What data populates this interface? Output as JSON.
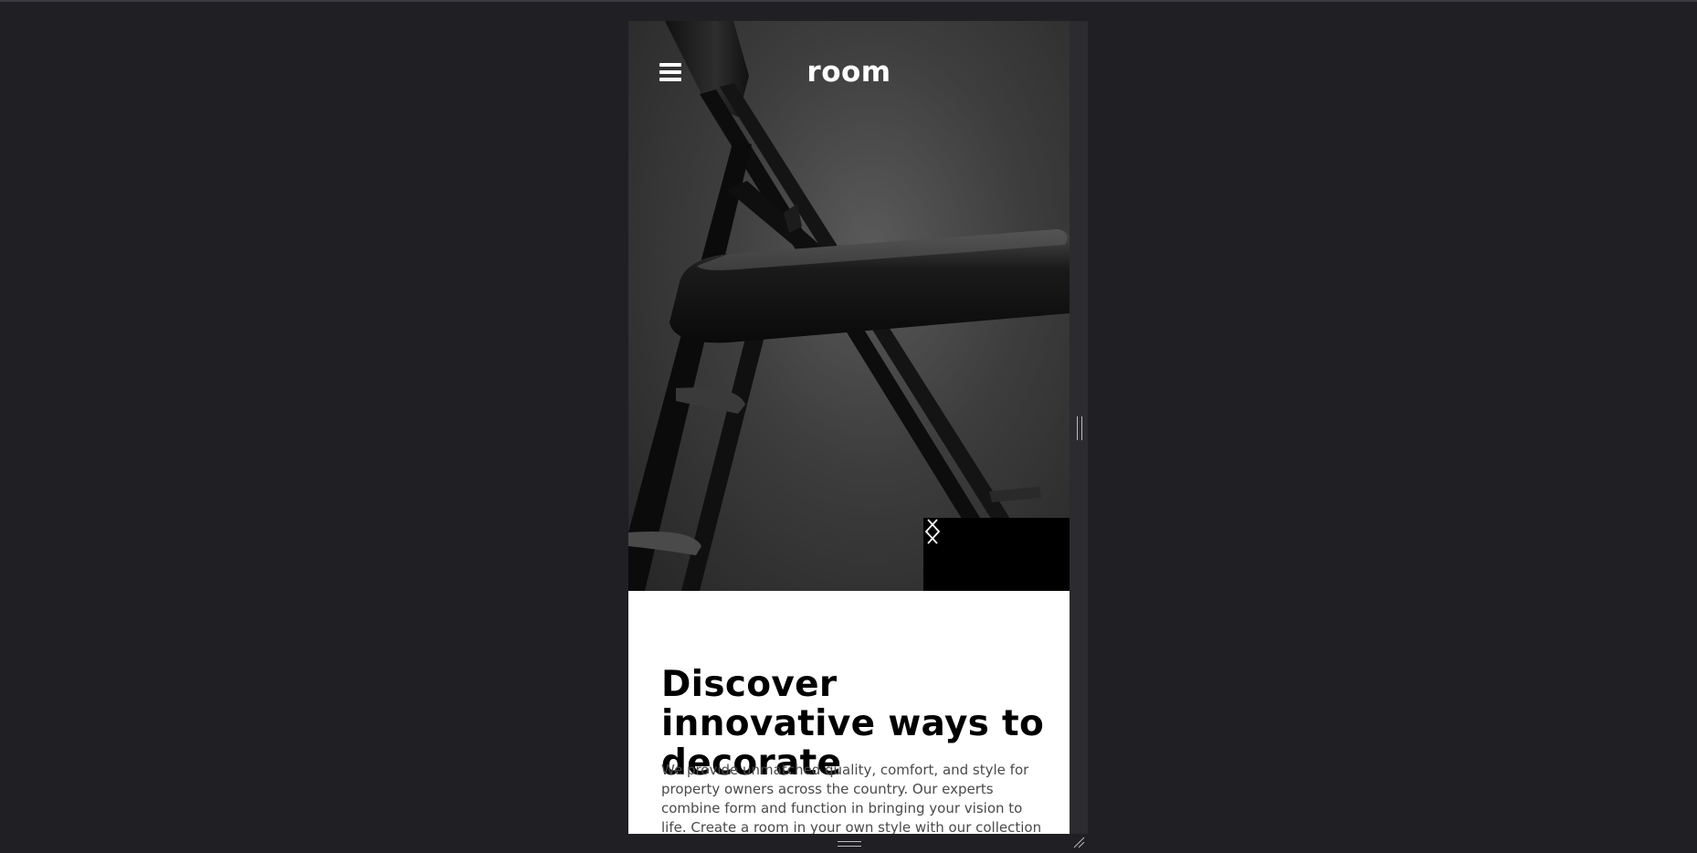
{
  "header": {
    "brand": "room",
    "menu_icon": "hamburger-menu-icon"
  },
  "hero": {
    "image_subject": "black folding chair",
    "prev_icon": "chevron-left-icon",
    "next_icon": "chevron-right-icon"
  },
  "content": {
    "headline": "Discover innovative ways to decorate",
    "body": "We provide unmatched quality, comfort, and style for property owners across the country. Our experts combine form and function in bringing your vision to life. Create a room in your own style with our collection"
  },
  "colors": {
    "page_background": "#202024",
    "frame": "#2b2b30",
    "nav_background": "#000000",
    "text_primary": "#000000",
    "text_body": "#4a4a4a"
  }
}
